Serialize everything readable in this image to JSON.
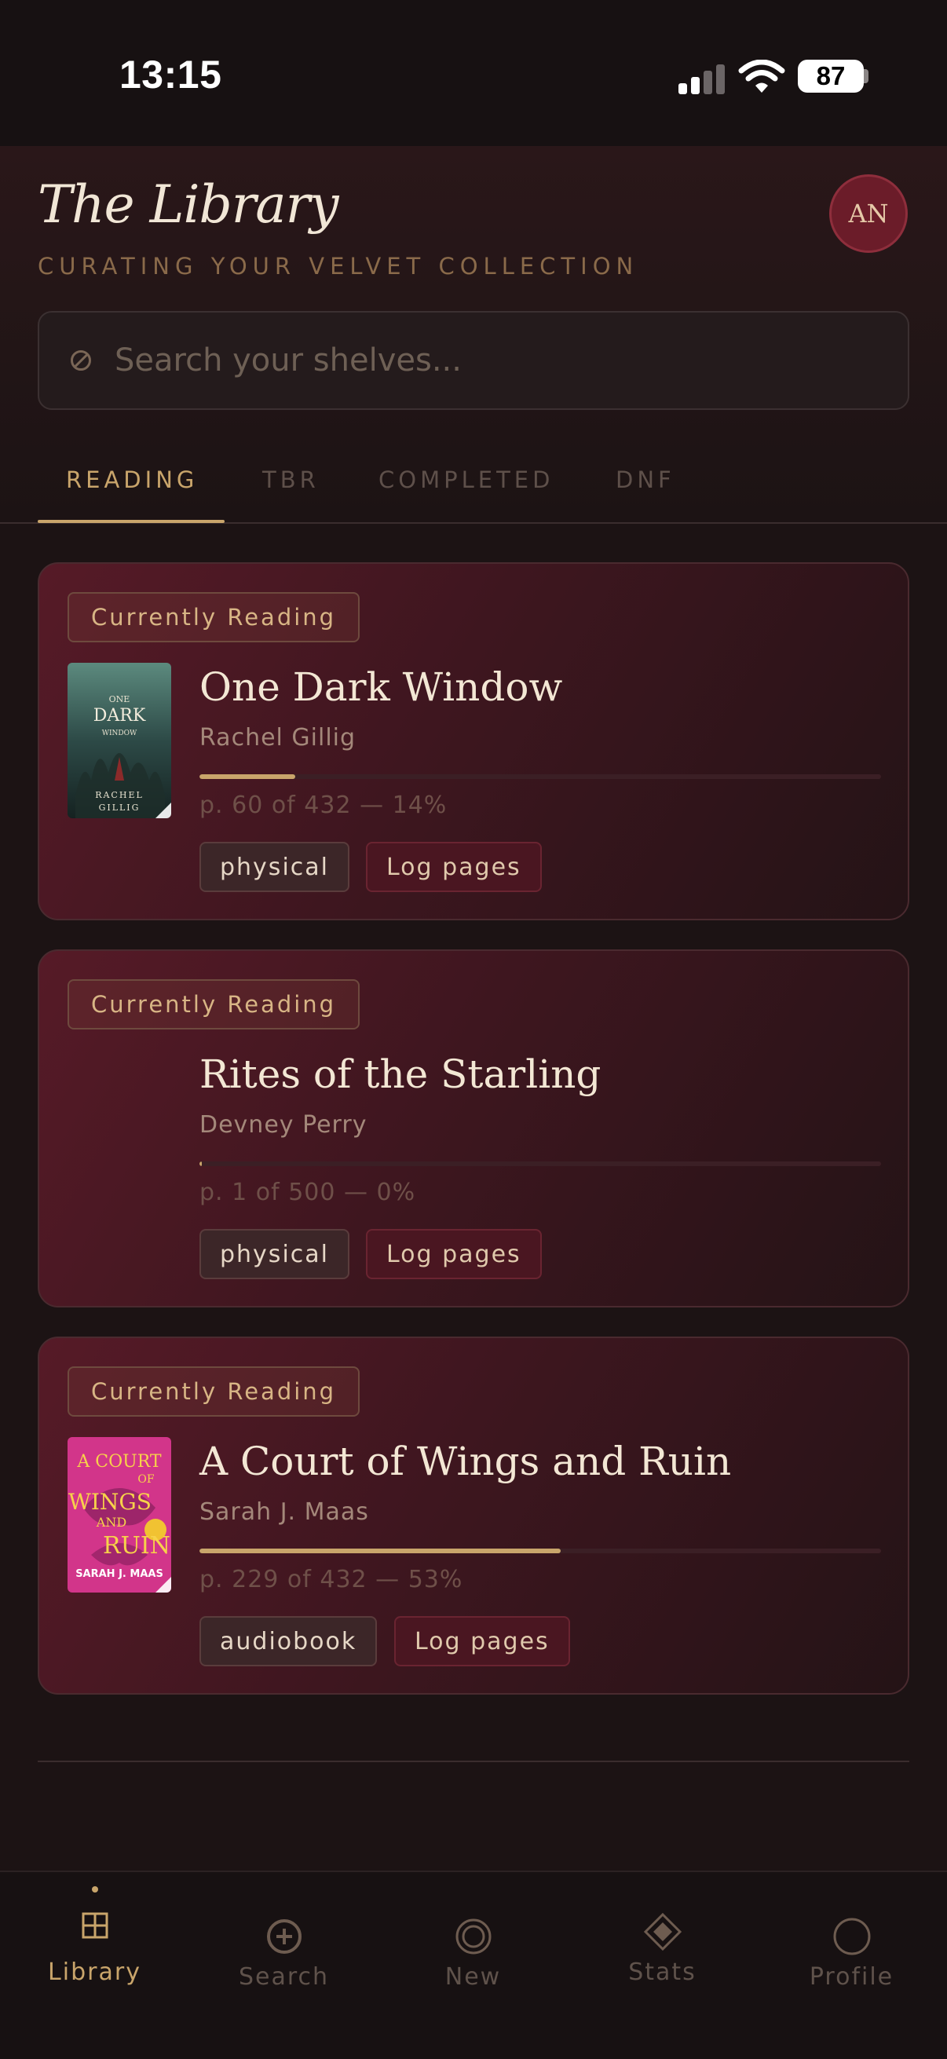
{
  "status_bar": {
    "time": "13:15",
    "battery": "87"
  },
  "header": {
    "title": "The Library",
    "subtitle": "CURATING YOUR VELVET COLLECTION",
    "avatar_initials": "AN"
  },
  "search": {
    "placeholder": "Search your shelves..."
  },
  "tabs": [
    {
      "label": "READING",
      "active": true
    },
    {
      "label": "TBR",
      "active": false
    },
    {
      "label": "COMPLETED",
      "active": false
    },
    {
      "label": "DNF",
      "active": false
    }
  ],
  "books": [
    {
      "badge": "Currently Reading",
      "title": "One Dark Window",
      "author": "Rachel Gillig",
      "progress_percent": 14,
      "progress_text": "p. 60 of 432 — 14%",
      "format": "physical",
      "action": "Log pages",
      "cover": {
        "line1": "ONE",
        "line2": "DARK",
        "line3": "WINDOW",
        "author_top": "RACHEL",
        "author_bottom": "GILLIG"
      }
    },
    {
      "badge": "Currently Reading",
      "title": "Rites of the Starling",
      "author": "Devney Perry",
      "progress_percent": 0,
      "progress_text": "p. 1 of 500 — 0%",
      "format": "physical",
      "action": "Log pages"
    },
    {
      "badge": "Currently Reading",
      "title": "A Court of Wings and Ruin",
      "author": "Sarah J. Maas",
      "progress_percent": 53,
      "progress_text": "p. 229 of 432 — 53%",
      "format": "audiobook",
      "action": "Log pages",
      "cover": {
        "line1": "A COURT",
        "line2": "OF",
        "line3": "WINGS",
        "line4": "AND",
        "line5": "RUIN",
        "author": "SARAH J. MAAS"
      }
    }
  ],
  "nav": [
    {
      "label": "Library",
      "icon": "grid-icon",
      "active": true
    },
    {
      "label": "Search",
      "icon": "plus-circle-icon",
      "active": false
    },
    {
      "label": "New",
      "icon": "target-icon",
      "active": false
    },
    {
      "label": "Stats",
      "icon": "diamond-icon",
      "active": false
    },
    {
      "label": "Profile",
      "icon": "circle-icon",
      "active": false
    }
  ],
  "colors": {
    "background": "#1c1314",
    "accent_gold": "#c9a56b",
    "card_burgundy": "#561a27",
    "avatar_red": "#6b1c29"
  }
}
